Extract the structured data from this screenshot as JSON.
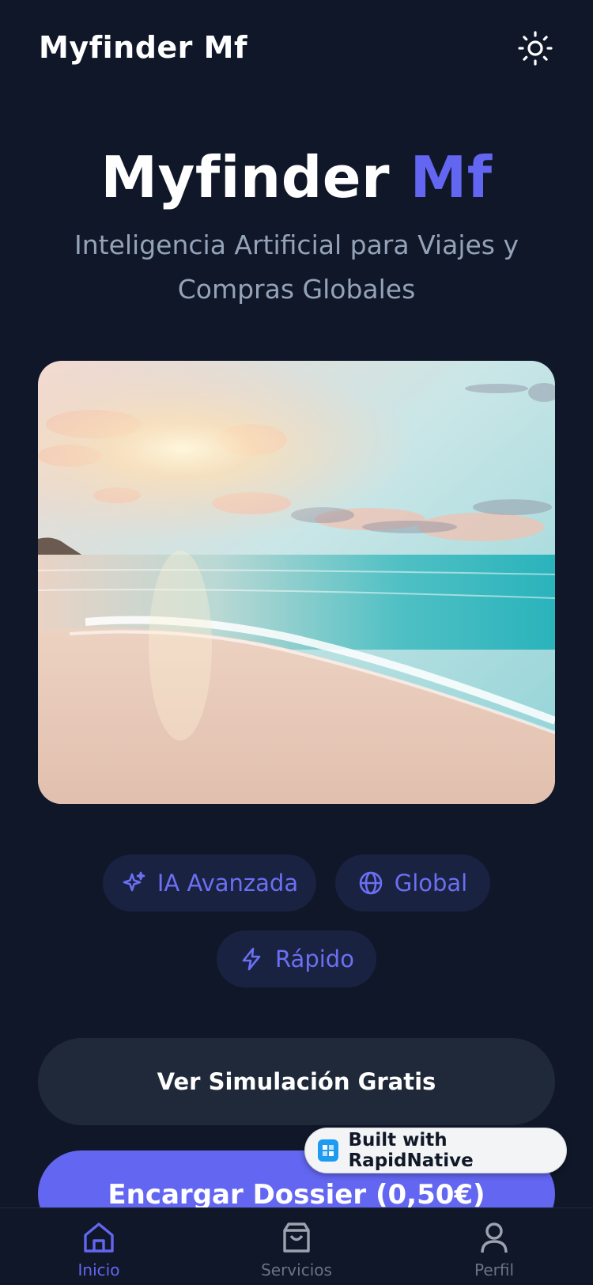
{
  "header": {
    "app_name": "Myfinder Mf",
    "theme_icon": "sun-icon"
  },
  "hero": {
    "title_main": "Myfinder",
    "title_accent": "Mf",
    "subtitle": "Inteligencia Artificial para Viajes y Compras Globales",
    "image": "beach-sunset-photo"
  },
  "features": [
    {
      "label": "IA Avanzada",
      "icon": "sparkles-icon"
    },
    {
      "label": "Global",
      "icon": "globe-icon"
    },
    {
      "label": "Rápido",
      "icon": "lightning-icon"
    }
  ],
  "actions": {
    "secondary_label": "Ver Simulación Gratis",
    "primary_label": "Encargar Dossier (0,50€)"
  },
  "badge": {
    "label": "Built with RapidNative"
  },
  "tabs": [
    {
      "label": "Inicio",
      "icon": "home-icon",
      "active": true
    },
    {
      "label": "Servicios",
      "icon": "shopping-bag-icon",
      "active": false
    },
    {
      "label": "Perfil",
      "icon": "user-icon",
      "active": false
    }
  ],
  "colors": {
    "background": "#101729",
    "accent": "#6366f1",
    "chip_bg": "#1a2241",
    "secondary_button": "#1f2939",
    "muted_text": "#94a3b8"
  }
}
